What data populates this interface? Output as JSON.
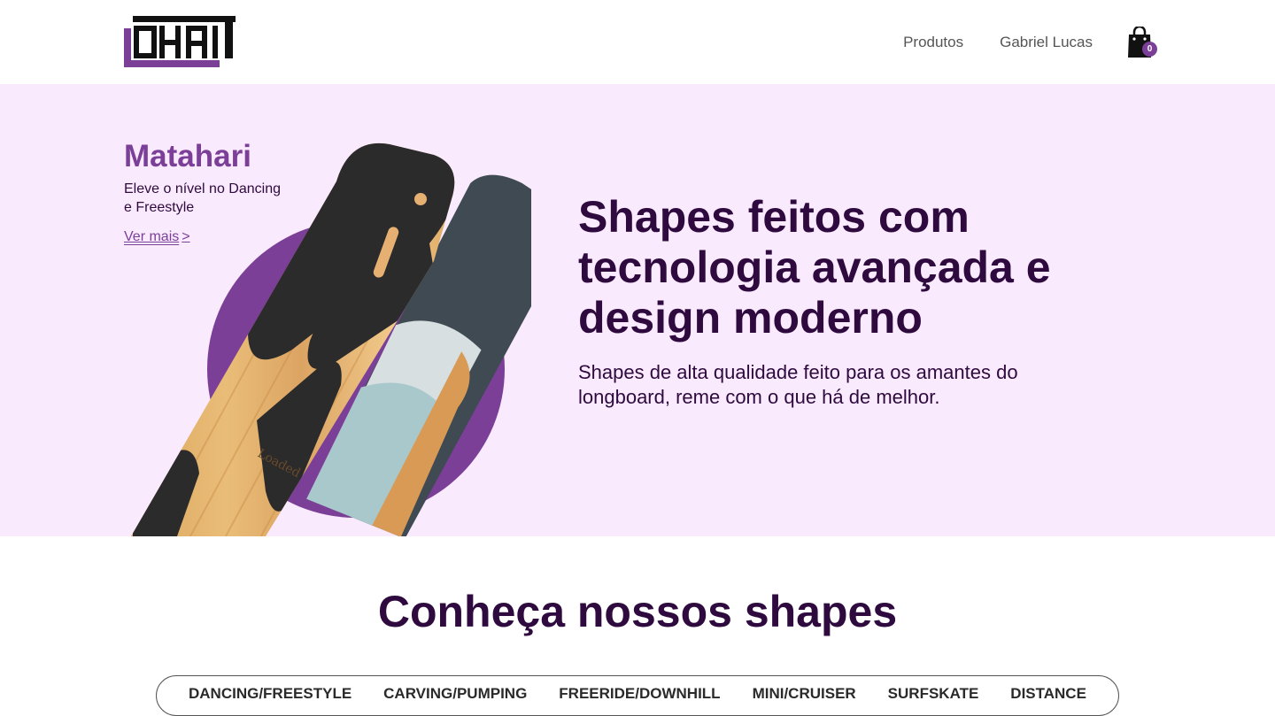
{
  "header": {
    "logo_text": "OHAI",
    "nav": [
      {
        "label": "Produtos"
      },
      {
        "label": "Gabriel Lucas"
      }
    ],
    "cart_count": "0"
  },
  "hero": {
    "product_name": "Matahari",
    "product_description": "Eleve o nível no Dancing e Freestyle",
    "link_label": "Ver mais",
    "link_arrow": ">",
    "heading": "Shapes feitos com tecnologia avançada e design moderno",
    "subheading": "Shapes de alta qualidade feito para os amantes do longboard, reme com o que há de melhor.",
    "board_brand": "Loaded"
  },
  "section": {
    "title": "Conheça nossos shapes",
    "tabs": [
      {
        "label": "DANCING/FREESTYLE"
      },
      {
        "label": "CARVING/PUMPING"
      },
      {
        "label": "FREERIDE/DOWNHILL"
      },
      {
        "label": "MINI/CRUISER"
      },
      {
        "label": "SURFSKATE"
      },
      {
        "label": "DISTANCE"
      }
    ]
  },
  "colors": {
    "brand_purple": "#7b3f98",
    "dark_purple": "#2e0a3f",
    "hero_background": "#faeafd"
  }
}
